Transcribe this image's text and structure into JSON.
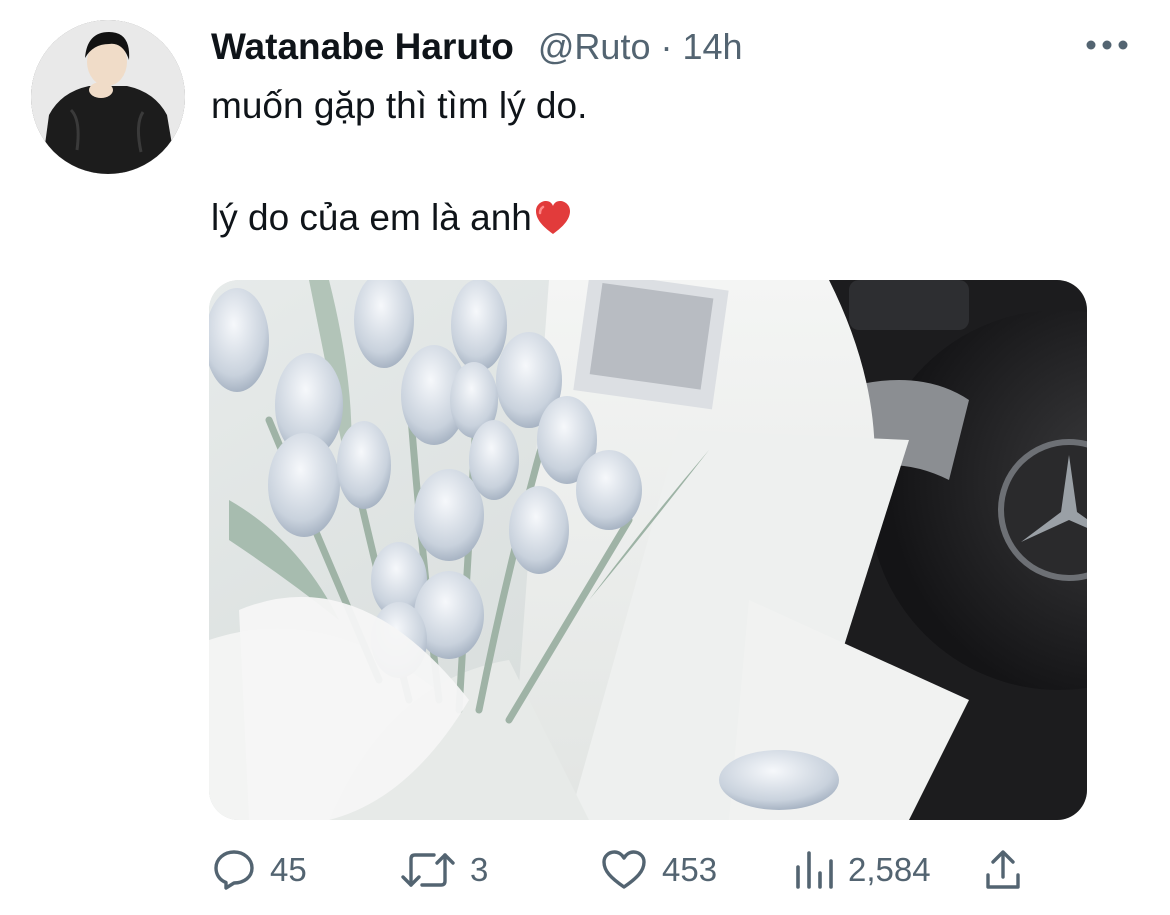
{
  "author": {
    "display_name": "Watanabe Haruto",
    "handle": "@Ruto",
    "separator": "·",
    "timestamp": "14h"
  },
  "tweet": {
    "line1": "muốn gặp thì tìm lý do.",
    "line2": "lý do của em là anh",
    "emoji": "heart-emoji"
  },
  "media": {
    "type": "photo",
    "subject": "white tulip bouquet in car"
  },
  "actions": {
    "replies": "45",
    "retweets": "3",
    "likes": "453",
    "views": "2,584"
  },
  "colors": {
    "text_primary": "#0f1419",
    "text_secondary": "#536471",
    "heart": "#e0245e"
  }
}
